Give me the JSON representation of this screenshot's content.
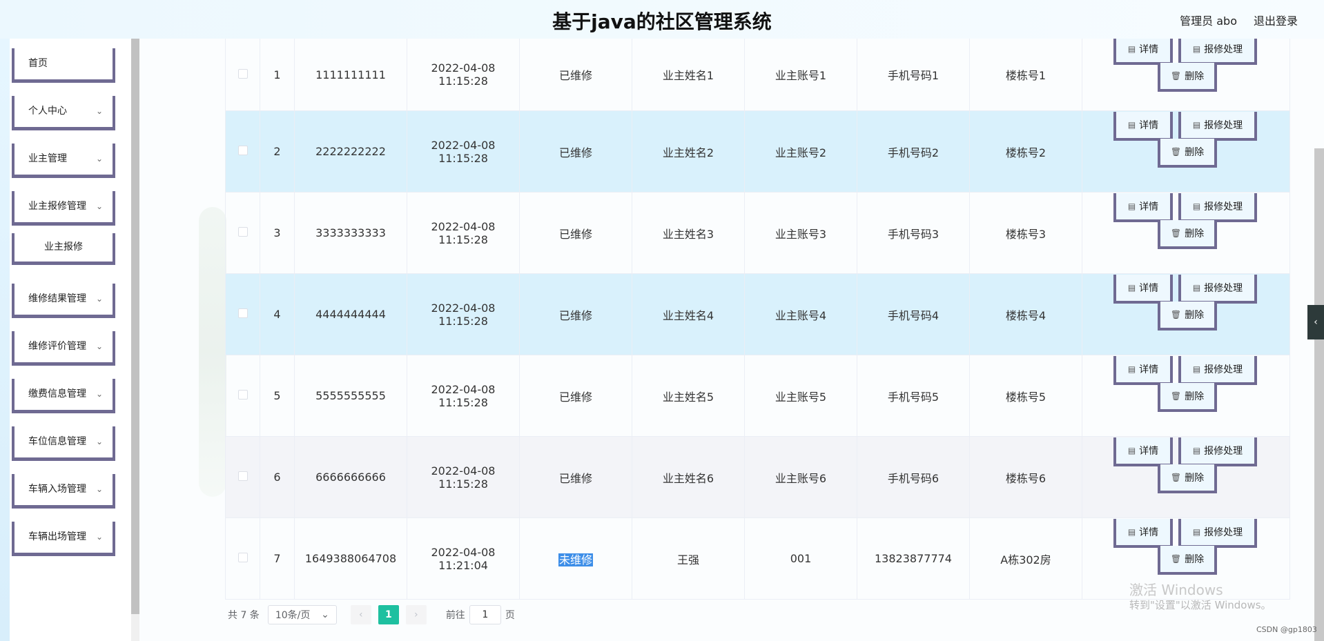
{
  "header": {
    "title": "基于java的社区管理系统",
    "user": "管理员 abo",
    "logout": "退出登录"
  },
  "sidebar": {
    "items": [
      {
        "label": "首页",
        "chevron": false
      },
      {
        "label": "个人中心",
        "chevron": true
      },
      {
        "label": "业主管理",
        "chevron": true
      },
      {
        "label": "业主报修管理",
        "chevron": true
      },
      {
        "label": "业主报修",
        "chevron": false,
        "sub": true
      },
      {
        "label": "维修结果管理",
        "chevron": true
      },
      {
        "label": "维修评价管理",
        "chevron": true
      },
      {
        "label": "缴费信息管理",
        "chevron": true
      },
      {
        "label": "车位信息管理",
        "chevron": true
      },
      {
        "label": "车辆入场管理",
        "chevron": true
      },
      {
        "label": "车辆出场管理",
        "chevron": true
      }
    ]
  },
  "table": {
    "buttons": {
      "detail": "详情",
      "repair": "报修处理",
      "delete": "删除"
    },
    "rows": [
      {
        "index": "1",
        "number": "1111111111",
        "time": "2022-04-08 11:15:28",
        "status": "已维修",
        "name": "业主姓名1",
        "account": "业主账号1",
        "phone": "手机号码1",
        "building": "楼栋号1",
        "style": "first"
      },
      {
        "index": "2",
        "number": "2222222222",
        "time": "2022-04-08 11:15:28",
        "status": "已维修",
        "name": "业主姓名2",
        "account": "业主账号2",
        "phone": "手机号码2",
        "building": "楼栋号2",
        "style": "alt"
      },
      {
        "index": "3",
        "number": "3333333333",
        "time": "2022-04-08 11:15:28",
        "status": "已维修",
        "name": "业主姓名3",
        "account": "业主账号3",
        "phone": "手机号码3",
        "building": "楼栋号3",
        "style": ""
      },
      {
        "index": "4",
        "number": "4444444444",
        "time": "2022-04-08 11:15:28",
        "status": "已维修",
        "name": "业主姓名4",
        "account": "业主账号4",
        "phone": "手机号码4",
        "building": "楼栋号4",
        "style": "alt"
      },
      {
        "index": "5",
        "number": "5555555555",
        "time": "2022-04-08 11:15:28",
        "status": "已维修",
        "name": "业主姓名5",
        "account": "业主账号5",
        "phone": "手机号码5",
        "building": "楼栋号5",
        "style": ""
      },
      {
        "index": "6",
        "number": "6666666666",
        "time": "2022-04-08 11:15:28",
        "status": "已维修",
        "name": "业主姓名6",
        "account": "业主账号6",
        "phone": "手机号码6",
        "building": "楼栋号6",
        "style": "hover"
      },
      {
        "index": "7",
        "number": "1649388064708",
        "time": "2022-04-08 11:21:04",
        "status": "未维修",
        "name": "王强",
        "account": "001",
        "phone": "13823877774",
        "building": "A栋302房",
        "style": "",
        "status_selected": true
      }
    ]
  },
  "pagination": {
    "total": "共 7 条",
    "page_size": "10条/页",
    "current_page": "1",
    "goto_label": "前往",
    "goto_value": "1",
    "page_unit": "页"
  },
  "watermark": {
    "line1": "激活 Windows",
    "line2": "转到\"设置\"以激活 Windows。"
  },
  "credit": "CSDN @gp1803",
  "colors": {
    "accent": "#1ec0a0",
    "button_border": "#6f6a92",
    "row_alt": "#d9f1fc",
    "selection": "#3d8ee8"
  }
}
